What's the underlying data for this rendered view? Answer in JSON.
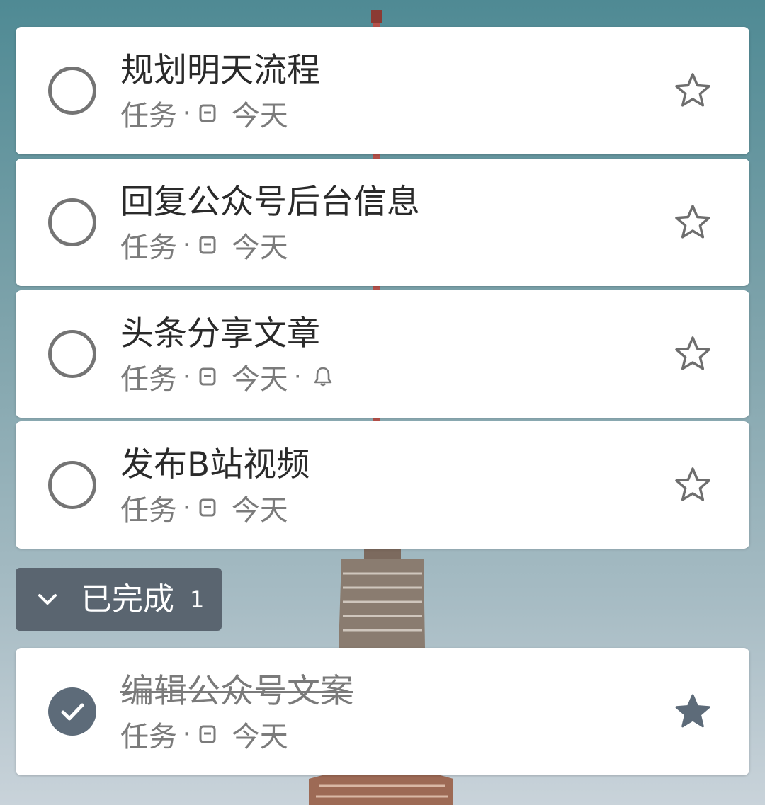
{
  "tasks": [
    {
      "title": "规划明天流程",
      "meta_type": "任务",
      "separator": "·",
      "due": "今天",
      "has_reminder": false,
      "completed": false,
      "starred": false
    },
    {
      "title": "回复公众号后台信息",
      "meta_type": "任务",
      "separator": "·",
      "due": "今天",
      "has_reminder": false,
      "completed": false,
      "starred": false
    },
    {
      "title": "头条分享文章",
      "meta_type": "任务",
      "separator": "·",
      "due": "今天",
      "separator2": "·",
      "has_reminder": true,
      "completed": false,
      "starred": false
    },
    {
      "title": "发布B站视频",
      "meta_type": "任务",
      "separator": "·",
      "due": "今天",
      "has_reminder": false,
      "completed": false,
      "starred": false
    }
  ],
  "completed_section": {
    "label": "已完成",
    "count": "1",
    "expanded": true
  },
  "completed_tasks": [
    {
      "title": "编辑公众号文案",
      "meta_type": "任务",
      "separator": "·",
      "due": "今天",
      "has_reminder": false,
      "completed": true,
      "starred": true
    }
  ],
  "colors": {
    "card_bg": "#ffffff",
    "title_text": "#2a2a2a",
    "meta_text": "#7b7b7b",
    "check_border": "#747474",
    "done_fill": "#5d6b79",
    "section_bg": "#5a6570",
    "star_filled": "#5d6b79"
  },
  "icons": {
    "calendar": "calendar-icon",
    "reminder": "bell-icon",
    "star_outline": "star-outline-icon",
    "star_filled": "star-filled-icon",
    "check": "checkmark-icon",
    "chevron": "chevron-down-icon"
  }
}
